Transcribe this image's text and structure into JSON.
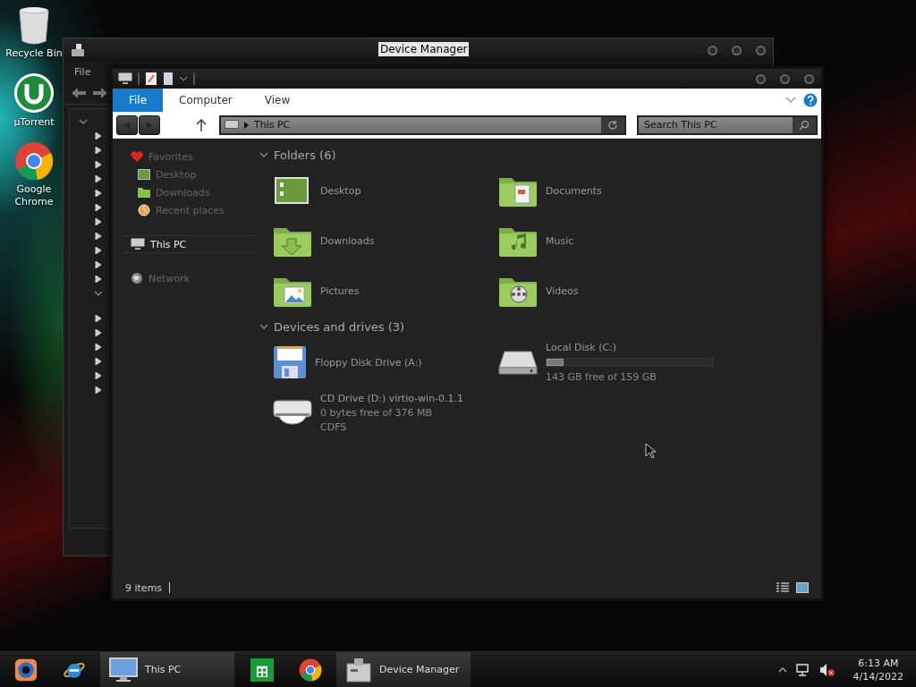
{
  "desktop_icons": [
    {
      "label": "Recycle Bin"
    },
    {
      "label": "µTorrent"
    },
    {
      "label": "Google Chrome"
    }
  ],
  "device_manager": {
    "title": "Device Manager",
    "menu": [
      "File"
    ],
    "tree": {
      "expanded": true,
      "children": [
        {
          "expanded": false
        },
        {
          "expanded": false
        },
        {
          "expanded": false
        },
        {
          "expanded": false
        },
        {
          "expanded": false
        },
        {
          "expanded": false
        },
        {
          "expanded": false
        },
        {
          "expanded": false
        },
        {
          "expanded": false
        },
        {
          "expanded": false
        },
        {
          "expanded": false
        },
        {
          "expanded": true
        },
        {
          "expanded": false
        },
        {
          "expanded": false
        },
        {
          "expanded": false
        },
        {
          "expanded": false
        },
        {
          "expanded": false
        },
        {
          "expanded": false
        }
      ]
    }
  },
  "explorer": {
    "ribbon_tabs": [
      {
        "label": "File",
        "selected": true
      },
      {
        "label": "Computer",
        "selected": false
      },
      {
        "label": "View",
        "selected": false
      }
    ],
    "address": "This PC",
    "search": {
      "placeholder": "Search This PC"
    },
    "nav": [
      {
        "label": "Favorites",
        "selected": false,
        "children": [
          {
            "label": "Desktop",
            "selected": false
          },
          {
            "label": "Downloads",
            "selected": false
          },
          {
            "label": "Recent places",
            "selected": false
          }
        ]
      },
      {
        "label": "This PC",
        "selected": true
      },
      {
        "label": "Network",
        "selected": false
      }
    ],
    "sections": [
      {
        "title": "Folders (6)",
        "expanded": true,
        "items": [
          {
            "kind": "folder",
            "name": "Desktop"
          },
          {
            "kind": "folder",
            "name": "Documents"
          },
          {
            "kind": "folder",
            "name": "Downloads"
          },
          {
            "kind": "folder",
            "name": "Music"
          },
          {
            "kind": "folder",
            "name": "Pictures"
          },
          {
            "kind": "folder",
            "name": "Videos"
          }
        ]
      },
      {
        "title": "Devices and drives (3)",
        "expanded": true,
        "items": [
          {
            "kind": "floppy",
            "name": "Floppy Disk Drive (A:)"
          },
          {
            "kind": "disk",
            "name": "Local Disk (C:)",
            "level": 0.1,
            "details": [
              "143 GB free of 159 GB"
            ]
          },
          {
            "kind": "cd",
            "name": "CD Drive (D:) virtio-win-0.1.1",
            "details": [
              "0 bytes free of 376 MB",
              "CDFS"
            ]
          }
        ]
      }
    ],
    "status_bar": {
      "count": "9 items"
    }
  },
  "taskbar": {
    "items": [
      {
        "kind": "pinned"
      },
      {
        "kind": "pinned"
      },
      {
        "kind": "window",
        "label": "This PC"
      },
      {
        "kind": "pinned"
      },
      {
        "kind": "pinned"
      },
      {
        "kind": "window",
        "label": "Device Manager"
      }
    ],
    "time": "6:13 AM",
    "date": "4/14/2022"
  }
}
